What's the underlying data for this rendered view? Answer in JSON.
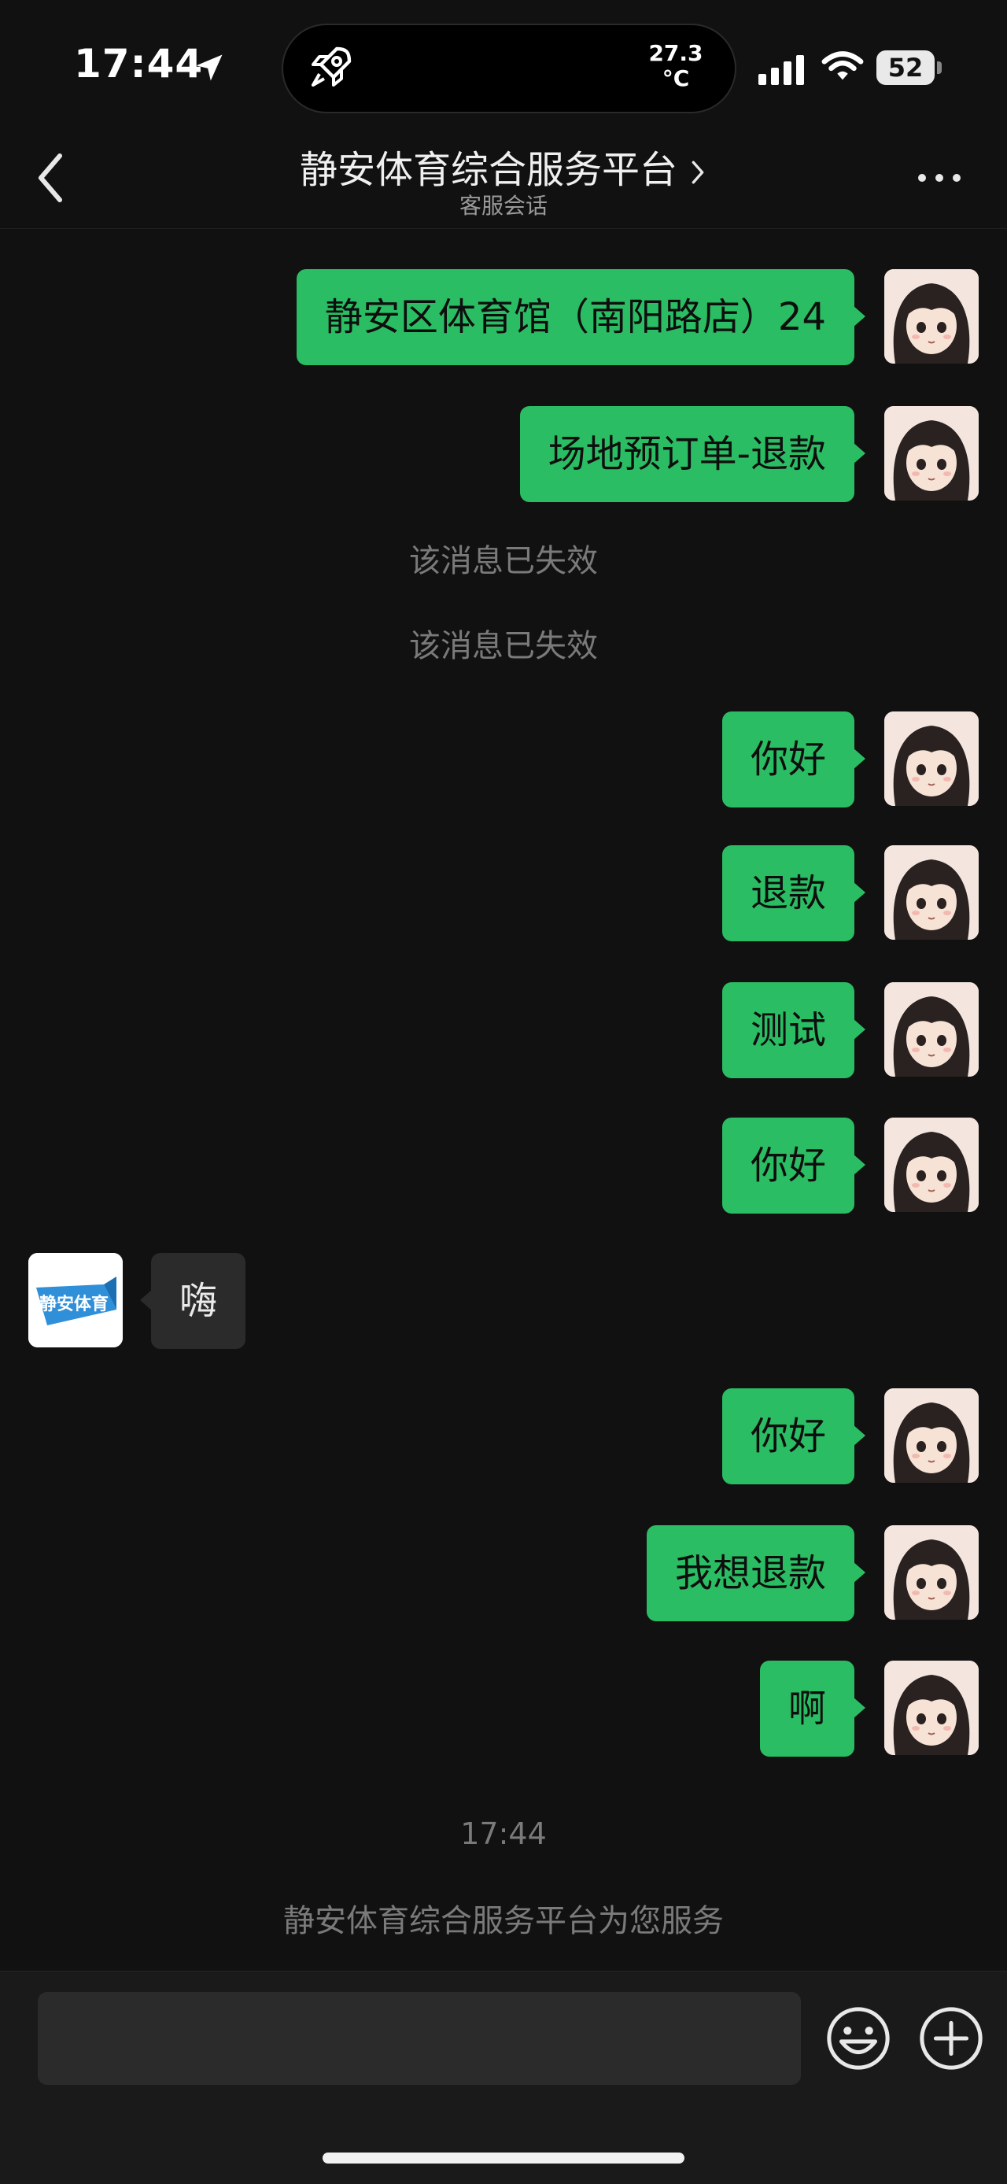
{
  "status_bar": {
    "time": "17:44",
    "temperature": "27.3\n°C",
    "battery": "52"
  },
  "nav": {
    "title": "静安体育综合服务平台",
    "subtitle": "客服会话"
  },
  "messages": [
    {
      "side": "out",
      "text": "静安区体育馆（南阳路店）24"
    },
    {
      "side": "out",
      "text": "场地预订单-退款"
    },
    {
      "side": "system",
      "text": "该消息已失效"
    },
    {
      "side": "system",
      "text": "该消息已失效"
    },
    {
      "side": "out",
      "text": "你好"
    },
    {
      "side": "out",
      "text": "退款"
    },
    {
      "side": "out",
      "text": "测试"
    },
    {
      "side": "out",
      "text": "你好"
    },
    {
      "side": "in",
      "text": "嗨"
    },
    {
      "side": "out",
      "text": "你好"
    },
    {
      "side": "out",
      "text": "我想退款"
    },
    {
      "side": "out",
      "text": "啊"
    }
  ],
  "footer_notes": {
    "timestamp": "17:44",
    "service_note": "静安体育综合服务平台为您服务"
  },
  "shop_avatar_logo_text": "静安体育",
  "input": {
    "value": "",
    "placeholder": ""
  },
  "colors": {
    "background": "#111111",
    "outgoing_bubble": "#2bbd63",
    "incoming_bubble": "#2b2b2b",
    "system_text": "#7a7a7a"
  },
  "icons": {
    "location": "location-arrow-icon",
    "dynamic_island": "rocket-icon",
    "signal": "cellular-signal-icon",
    "wifi": "wifi-icon",
    "back": "chevron-left-icon",
    "title_chevron": "chevron-right-icon",
    "more": "more-dots-icon",
    "emoji": "emoji-icon",
    "plus": "plus-circle-icon"
  }
}
